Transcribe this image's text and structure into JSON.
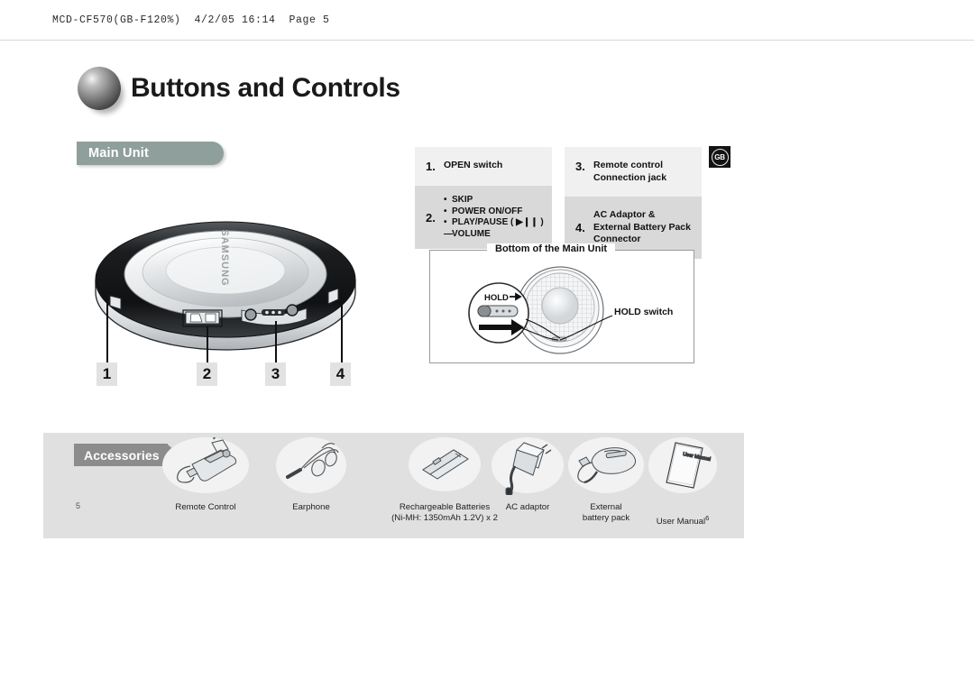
{
  "print_header": "MCD-CF570(GB-F120%)  4/2/05 16:14  Page 5",
  "page_title": "Buttons and Controls",
  "section": {
    "main_unit_label": "Main Unit"
  },
  "locale_badge": "GB",
  "callouts": {
    "left": [
      {
        "num": "1.",
        "text": "OPEN switch"
      },
      {
        "num": "2.",
        "bullets": [
          "SKIP",
          "POWER ON/OFF",
          "PLAY/PAUSE ( ▶❙❙ )"
        ],
        "dash_item": "VOLUME"
      }
    ],
    "right": [
      {
        "num": "3.",
        "text": "Remote control Connection jack"
      },
      {
        "num": "4.",
        "text": "AC Adaptor & External Battery Pack Connector"
      }
    ]
  },
  "callout_items": {
    "one": "OPEN switch",
    "two_b1": "SKIP",
    "two_b2": "POWER ON/OFF",
    "two_b3": "PLAY/PAUSE ( ▶❙❙ )",
    "two_b4": "VOLUME",
    "three": "Remote control Connection jack",
    "four": "AC Adaptor & External Battery Pack Connector",
    "num1": "1.",
    "num2": "2.",
    "num3": "3.",
    "num4": "4."
  },
  "number_chips": [
    "1",
    "2",
    "3",
    "4"
  ],
  "bottom_figure": {
    "legend": "Bottom of the Main Unit",
    "hold_switch_label": "HOLD switch",
    "magnifier_text": "HOLD"
  },
  "device": {
    "brand": "SAMSUNG"
  },
  "accessories": {
    "banner": "Accessories",
    "page_number": "5",
    "items": [
      {
        "name": "remote-control",
        "label": "Remote Control"
      },
      {
        "name": "earphone",
        "label": "Earphone"
      },
      {
        "name": "rechargeable-batteries",
        "label": "Rechargeable Batteries\n(Ni-MH: 1350mAh 1.2V) x 2"
      },
      {
        "name": "ac-adaptor",
        "label": "AC adaptor"
      },
      {
        "name": "external-battery-pack",
        "label": "External\nbattery pack"
      },
      {
        "name": "user-manual",
        "label": "User Manual",
        "superscript": "6"
      }
    ]
  },
  "colors": {
    "banner_teal": "#8f9f9b",
    "banner_gray": "#8c8c8c",
    "panel_gray": "#e0e0e0",
    "row_light": "#f0f0f0",
    "row_dark": "#d9d9d9",
    "chip_gray": "#e2e2e2"
  }
}
